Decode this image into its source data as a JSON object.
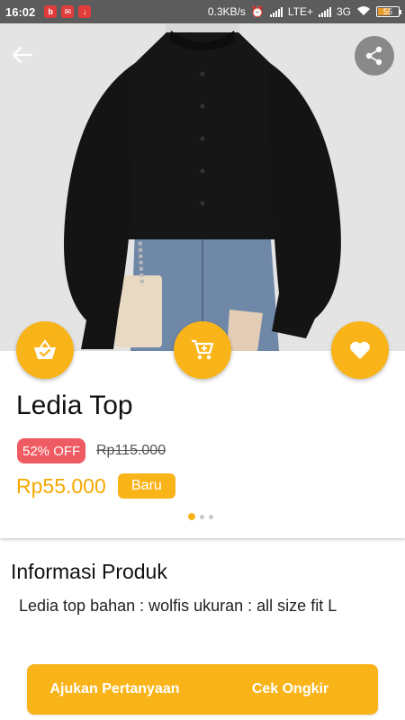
{
  "status_bar": {
    "time": "16:02",
    "network_speed": "0.3KB/s",
    "network_1": "LTE+",
    "network_2": "3G",
    "battery": "55",
    "notification_icons": [
      "app-notification-icon",
      "mail-notification-icon",
      "download-notification-icon"
    ]
  },
  "header": {
    "back_icon": "arrow-left-icon",
    "share_icon": "share-icon"
  },
  "actions": {
    "basket_icon": "basket-check-icon",
    "cart_icon": "cart-plus-icon",
    "wishlist_icon": "heart-icon"
  },
  "product": {
    "title": "Ledia Top",
    "discount": "52% OFF",
    "original_price": "Rp115.000",
    "price": "Rp55.000",
    "condition": "Baru",
    "image_pages": 3,
    "current_page": 1
  },
  "info": {
    "section_title": "Informasi Produk",
    "description": "Ledia top bahan : wolfis ukuran : all size fit L"
  },
  "bottom_bar": {
    "ask_label": "Ajukan Pertanyaan",
    "shipping_label": "Cek Ongkir"
  },
  "colors": {
    "accent": "#f9b41a",
    "price": "#f5a800",
    "discount": "#ef5b62"
  }
}
